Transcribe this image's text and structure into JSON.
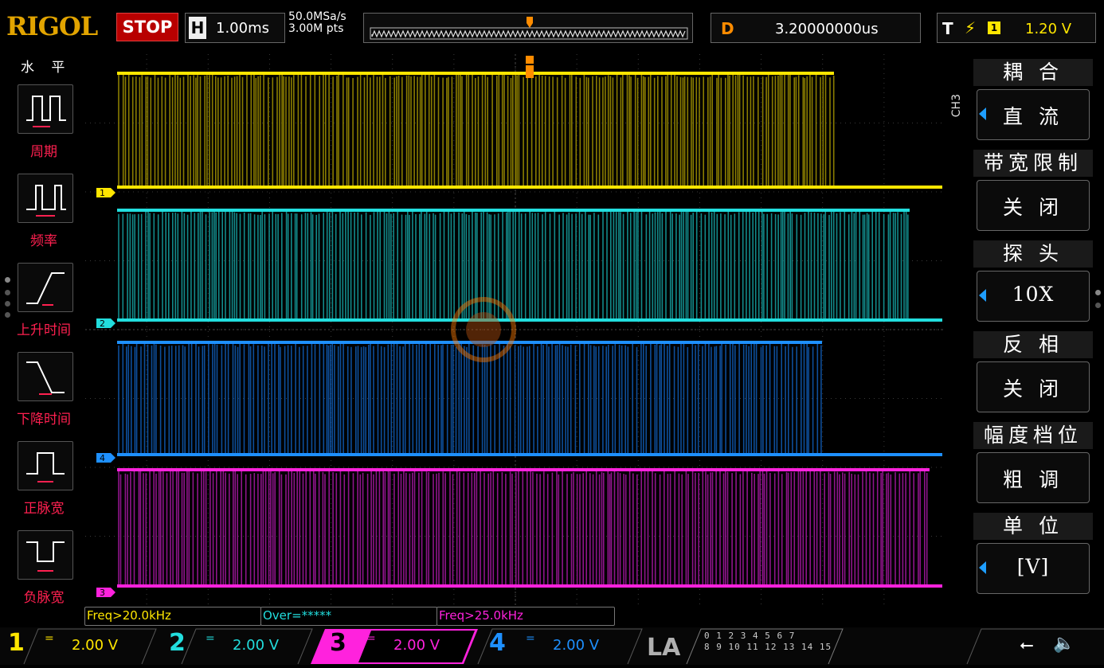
{
  "top": {
    "logo": "RIGOL",
    "run_state": "STOP",
    "h_key": "H",
    "timebase": "1.00ms",
    "sample_rate": "50.0MSa/s",
    "memory_depth": "3.00M pts",
    "delay_key": "D",
    "delay": "3.20000000us",
    "trigger_key": "T",
    "trigger_source": "1",
    "trigger_level": "1.20 V"
  },
  "left_menu": {
    "title": "水 平",
    "items": [
      {
        "label": "周期",
        "icon": "period-icon"
      },
      {
        "label": "频率",
        "icon": "frequency-icon"
      },
      {
        "label": "上升时间",
        "icon": "rise-time-icon"
      },
      {
        "label": "下降时间",
        "icon": "fall-time-icon"
      },
      {
        "label": "正脉宽",
        "icon": "positive-width-icon"
      },
      {
        "label": "负脉宽",
        "icon": "negative-width-icon"
      }
    ]
  },
  "right_menu": {
    "channel_tag": "CH3",
    "items": [
      {
        "title": "耦 合",
        "value": "直 流",
        "arrow": true
      },
      {
        "title": "带宽限制",
        "value": "关 闭",
        "arrow": false
      },
      {
        "title": "探 头",
        "value": "10X",
        "arrow": true
      },
      {
        "title": "反 相",
        "value": "关 闭",
        "arrow": false
      },
      {
        "title": "幅度档位",
        "value": "粗 调",
        "arrow": false
      },
      {
        "title": "单 位",
        "value": "[V]",
        "arrow": true
      }
    ]
  },
  "measurements": [
    "Freq>20.0kHz",
    "Over=*****",
    "Freq>25.0kHz"
  ],
  "channels": [
    {
      "num": "1",
      "coupling": "=",
      "scale": "2.00 V",
      "color": "#ffe600"
    },
    {
      "num": "2",
      "coupling": "=",
      "scale": "2.00 V",
      "color": "#22dede"
    },
    {
      "num": "3",
      "coupling": "=",
      "scale": "2.00 V",
      "color": "#ff22dd"
    },
    {
      "num": "4",
      "coupling": "=",
      "scale": "2.00 V",
      "color": "#1e90ff"
    }
  ],
  "trace_markers": [
    "1",
    "2",
    "3",
    "4"
  ],
  "la": {
    "label": "LA",
    "row1": "0 1 2 3  4 5 6 7",
    "row2": "8 9 10 11  12 13 14 15"
  },
  "status_icons": [
    "usb-icon",
    "speaker-mute-icon"
  ],
  "colors": {
    "ch1": "#ffe600",
    "ch2": "#22dede",
    "ch3": "#ff22dd",
    "ch4": "#1e90ff",
    "trigger": "#ff8c00"
  }
}
